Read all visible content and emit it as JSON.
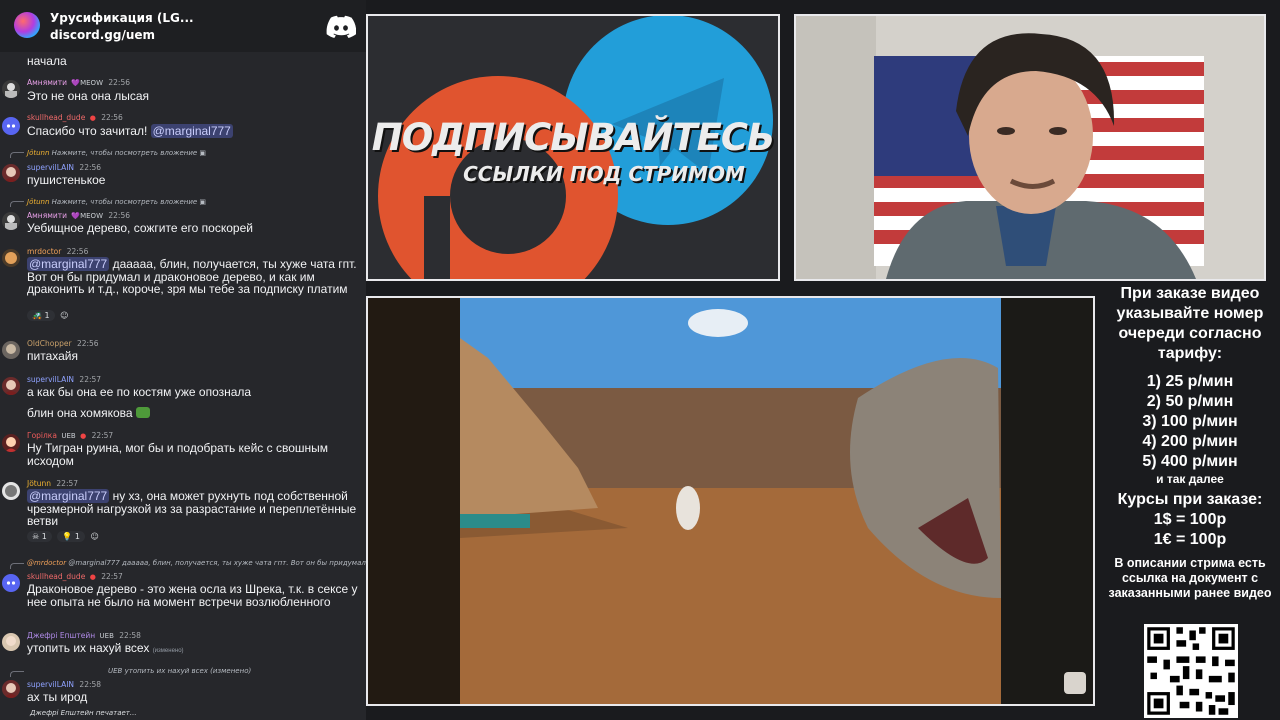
{
  "server": {
    "name": "Урусификация (LG...",
    "invite": "discord.gg/uem"
  },
  "messages": [
    {
      "partial_text": "начала"
    },
    {
      "author": "Амнямити",
      "badge": "💜MEOW",
      "time": "22:56",
      "author_color": "#e8a0e8",
      "text": "Это не она она лысая"
    },
    {
      "author": "skullhead_dude",
      "time": "22:56",
      "author_color": "#ef6a6a",
      "text_before": "Спасибо что зачитал! ",
      "mention": "@marginal777"
    },
    {
      "reply_author": "Jötunn",
      "reply_text": "Нажмите, чтобы посмотреть вложение",
      "author": "supervilLAIN",
      "time": "22:56",
      "author_color": "#8fa2ff",
      "text": "пушистенькое"
    },
    {
      "reply_author": "Jötunn",
      "reply_text": "Нажмите, чтобы посмотреть вложение",
      "author": "Амнямити",
      "badge": "💜MEOW",
      "time": "22:56",
      "author_color": "#e8a0e8",
      "text": "Уебищное дерево, сожгите его поскорей"
    },
    {
      "author": "mrdoctor",
      "time": "22:56",
      "author_color": "#f0a15a",
      "mention": "@marginal777",
      "text_after": " дааааа, блин, получается, ты хуже чата гпт. Вот он бы придумал и драконовое дерево, и как им драконить и т.д., короче, зря мы тебе за подписку платим",
      "reaction_count": "1"
    },
    {
      "author": "OldChopper",
      "time": "22:56",
      "author_color": "#c8a06a",
      "text": "питахайя"
    },
    {
      "author": "supervilLAIN",
      "time": "22:57",
      "author_color": "#8fa2ff",
      "text": "а как бы она ее по костям уже опознала",
      "text2": "блин она хомякова"
    },
    {
      "author": "Горілка",
      "badge": "UEB",
      "time": "22:57",
      "author_color": "#f05c5c",
      "text": "Ну Тигран руина, мог бы и подобрать кейс с свошным исходом"
    },
    {
      "author": "Jötunn",
      "time": "22:57",
      "author_color": "#f0b232",
      "mention": "@marginal777",
      "text_after": " ну хз, она может рухнуть под собственной чрезмерной нагрузкой из за разрастание и переплетённые ветви",
      "reaction_count_1": "1",
      "reaction_count_2": "1"
    },
    {
      "reply_author": "@mrdoctor",
      "reply_text": "@marginal777 дааааа, блин, получается, ты хуже чата гпт. Вот он бы придумал и драк...",
      "author": "skullhead_dude",
      "time": "22:57",
      "author_color": "#ef6a6a",
      "text": "Драконовое дерево - это жена осла из Шрека, т.к. в сексе у нее опыта не было на момент встречи возлюбленного"
    },
    {
      "author": "Джефрі Епштейн",
      "badge": "UEB",
      "time": "22:58",
      "author_color": "#b08be8",
      "text": "утопить их нахуй всех",
      "edited": "(изменено)"
    },
    {
      "reply_text": "утопить их нахуй всех (изменено)",
      "reply_badge": "UEB",
      "author": "supervilLAIN",
      "time": "22:58",
      "author_color": "#8fa2ff",
      "text": "ах ты ирод"
    }
  ],
  "typing": "Джефрі Епштейн печатает...",
  "promo": {
    "title": "ПОДПИСЫВАЙТЕСЬ",
    "subtitle": "ССЫЛКИ ПОД СТРИМОМ"
  },
  "info": {
    "order_note": "При заказе видео указывайте номер очереди согласно тарифу:",
    "tariffs": [
      "1) 25 р/мин",
      "2) 50 р/мин",
      "3) 100 р/мин",
      "4) 200 р/мин",
      "5) 400 р/мин"
    ],
    "and_so_on": "и так далее",
    "rates_title": "Курсы при заказе:",
    "rate_usd": "1$ = 100р",
    "rate_eur": "1€ = 100р",
    "description_note": "В описании стрима есть ссылка на документ с заказанными ранее видео"
  },
  "colors": {
    "chat_bg": "#26272b",
    "mention_bg": "#3c4270",
    "patreon": "#e0542f",
    "telegram": "#229ed9",
    "sky": "#4f97d8",
    "field": "#a46a3a"
  }
}
